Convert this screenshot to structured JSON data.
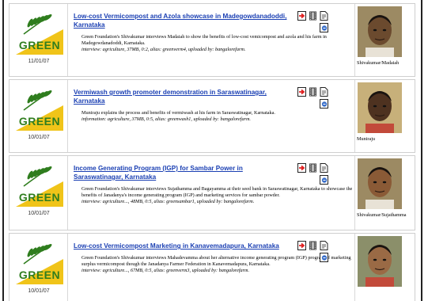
{
  "brand": {
    "logo_word": "GREEN",
    "green": "#2f7d1e",
    "yellow": "#f0c419"
  },
  "colors": {
    "link": "#1a3fb3"
  },
  "items": [
    {
      "title": "Low-cost Vermicompost and Azola showcase in Madegowdanadoddi, Karnataka",
      "date": "11/01/07",
      "description": "Green Foundation's Shivakumar interviews Madaiah to show the benefits of low-cost vemicompost and azola and his farm in Madegowdanadoddi, Karnataka.",
      "meta": "interview: agriculture, 37MB, 0:2, alias: greenverm4, uploaded by: bangalorefarm.",
      "caption": "Shivakumar/Madaiah",
      "skin": "#6b4a2e"
    },
    {
      "title": "Vermiwash growth promoter demonstration in Saraswatinagar, Karnataka",
      "date": "10/01/07",
      "description": "Muniraju explains the process and benefits of vermiwash at his farm in Saraswatinagar, Karnataka.",
      "meta": "information: agriculture, 37MB, 0:5, alias: greenwash1, uploaded by: bangalorefarm.",
      "caption": "Muniraju",
      "skin": "#4e3220"
    },
    {
      "title": "Income Generating Program (IGP) for Sambar Power in Saraswatinagar, Karnataka",
      "date": "10/01/07",
      "description": "Green Foundation's Shivakumar interviews Sujathamma and Bagayamma at their seed bank in Saraswatinagar, Karnataka to showcase the benefits of Janadanya's income generating program (IGP) and marketing services for sambar powder.",
      "meta": "interview: agriculture..., 48MB, 0:5, alias: greensambar1, uploaded by: bangalorefarm.",
      "caption": "Shivakumar/Sujathamma",
      "skin": "#8a5a36"
    },
    {
      "title": "Low-cost Vermicompost Marketing in Kanavemadapura, Karnataka",
      "date": "10/01/07",
      "description": "Green Foundation's Shivakumar interviews Mahadevamma about her alternative income generating program (IGP) program of marketing surplus vermicompost though the Janadanya Farmer Federation in Kanavemadapura, Karnataka.",
      "meta": "interview: agriculture..., 67MB, 0:5, alias: greenverm3, uploaded by: bangalorefarm.",
      "caption": "",
      "skin": "#9a6a45"
    }
  ]
}
